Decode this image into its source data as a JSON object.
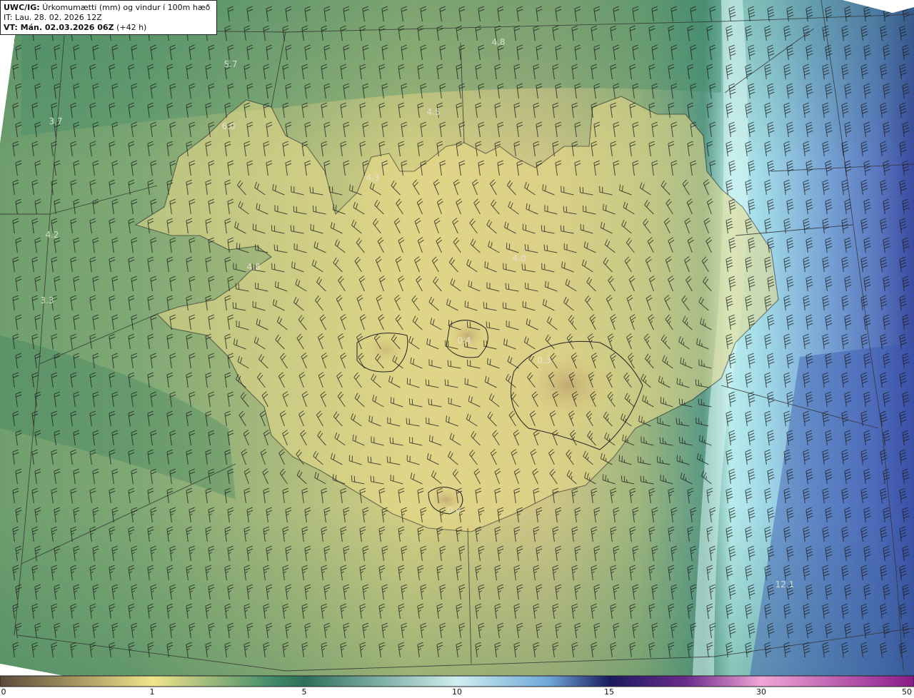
{
  "header": {
    "model": "UWC/IG:",
    "parameter": "Úrkomumætti (mm) og vindur í 100m hæð",
    "initial_time": "IT: Lau. 28. 02. 2026 12Z",
    "valid_prefix": "VT: Mán. 02.03.2026 06Z",
    "valid_suffix": "(+42 h)"
  },
  "colorbar": {
    "ticks": [
      "0",
      "1",
      "5",
      "10",
      "15",
      "30",
      "50"
    ],
    "colors": [
      "#5a4a3a",
      "#c9b47a",
      "#f2e48a",
      "#4f8f6f",
      "#2f6f5a",
      "#cfeef0",
      "#6fa8d8",
      "#3a56a8",
      "#1f1f6f",
      "#8a3a9a",
      "#f0a6d6",
      "#c040b0",
      "#8a1a8a"
    ]
  },
  "map_values": [
    "4.8",
    "5.7",
    "4.5",
    "3.7",
    "6.0",
    "4.3",
    "4.2",
    "4.8",
    "3.3",
    "4.0",
    "0.4",
    "0.3",
    "12.1",
    "0.4"
  ],
  "layers": {
    "precip_field": "precipitable-water",
    "wind": "wind-barbs-100m",
    "coastline": "iceland-coastline",
    "graticule": "lat-lon-grid"
  }
}
